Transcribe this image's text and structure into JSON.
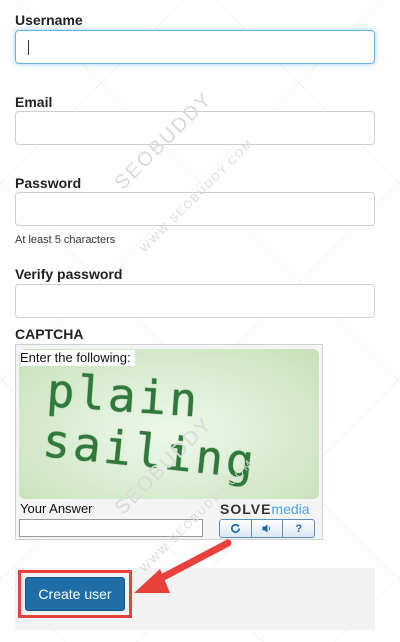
{
  "form": {
    "username_label": "Username",
    "username_value": "",
    "email_label": "Email",
    "email_value": "",
    "password_label": "Password",
    "password_value": "",
    "password_hint": "At least 5 characters",
    "verify_label": "Verify password",
    "verify_value": "",
    "captcha_label": "CAPTCHA"
  },
  "captcha": {
    "prompt": "Enter the following:",
    "word_1": "plain",
    "word_2": "sailing",
    "answer_label": "Your Answer",
    "answer_value": "",
    "brand_solve": "SOLVE",
    "brand_media": "media",
    "refresh_icon": "refresh-icon",
    "audio_icon": "speaker-icon",
    "help_symbol": "?"
  },
  "footer": {
    "create_label": "Create user"
  },
  "annotation": {
    "highlight_color": "#e8403a"
  },
  "watermark": {
    "brand": "SEOBUDDY",
    "url": "WWW.SEOBUDDY.COM"
  },
  "colors": {
    "focus_border": "#66afe9",
    "button_bg": "#1f6ea8",
    "captcha_text": "#2f7a3a"
  }
}
